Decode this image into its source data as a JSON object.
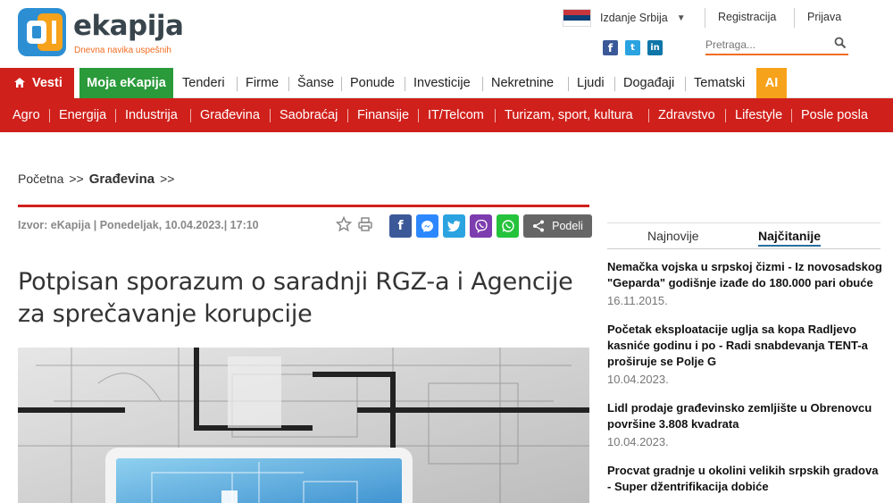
{
  "header": {
    "logo_text": "ekapija",
    "tagline": "Dnevna navika uspešnih",
    "edition_label": "Izdanje Srbija",
    "register_label": "Registracija",
    "login_label": "Prijava",
    "search_placeholder": "Pretraga...",
    "social": [
      "facebook-icon",
      "twitter-icon",
      "linkedin-icon"
    ]
  },
  "nav_main": [
    {
      "label": "Vesti",
      "icon": "home-icon"
    },
    {
      "label": "Moja eKapija"
    },
    {
      "label": "Tenderi"
    },
    {
      "label": "Firme"
    },
    {
      "label": "Šanse"
    },
    {
      "label": "Ponude"
    },
    {
      "label": "Investicije"
    },
    {
      "label": "Nekretnine"
    },
    {
      "label": "Ljudi"
    },
    {
      "label": "Događaji"
    },
    {
      "label": "Tematski"
    },
    {
      "label": "AI"
    }
  ],
  "nav_categories": [
    "Agro",
    "Energija",
    "Industrija",
    "Građevina",
    "Saobraćaj",
    "Finansije",
    "IT/Telcom",
    "Turizam, sport, kultura",
    "Zdravstvo",
    "Lifestyle",
    "Posle posla"
  ],
  "breadcrumb": {
    "home": "Početna",
    "sep": ">>",
    "current": "Građevina"
  },
  "article": {
    "meta": "Izvor: eKapija | Ponedeljak, 10.04.2023.| 17:10",
    "title": "Potpisan sporazum o saradnji RGZ-a i Agencije za sprečavanje korupcije",
    "share_label": "Podeli"
  },
  "sidebar": {
    "tabs": [
      "Najnovije",
      "Najčitanije"
    ],
    "active_tab": "Najčitanije",
    "items": [
      {
        "title": "Nemačka vojska u srpskoj čizmi - Iz novosadskog \"Geparda\" godišnje izađe do 180.000 pari obuće",
        "date": "16.11.2015."
      },
      {
        "title": "Početak eksploatacije uglja sa kopa Radljevo kasniće godinu i po - Radi snabdevanja TENT-a proširuje se Polje G",
        "date": "10.04.2023."
      },
      {
        "title": "Lidl prodaje građevinsko zemljište u Obrenovcu površine 3.808 kvadrata",
        "date": "10.04.2023."
      },
      {
        "title": "Procvat gradnje u okolini velikih srpskih gradova - Super džentrifikacija dobiće",
        "date": ""
      }
    ]
  },
  "colors": {
    "brand_red": "#d0201b",
    "brand_orange": "#f26d21",
    "green": "#2a9a3a",
    "ai_orange": "#f7a21b"
  }
}
